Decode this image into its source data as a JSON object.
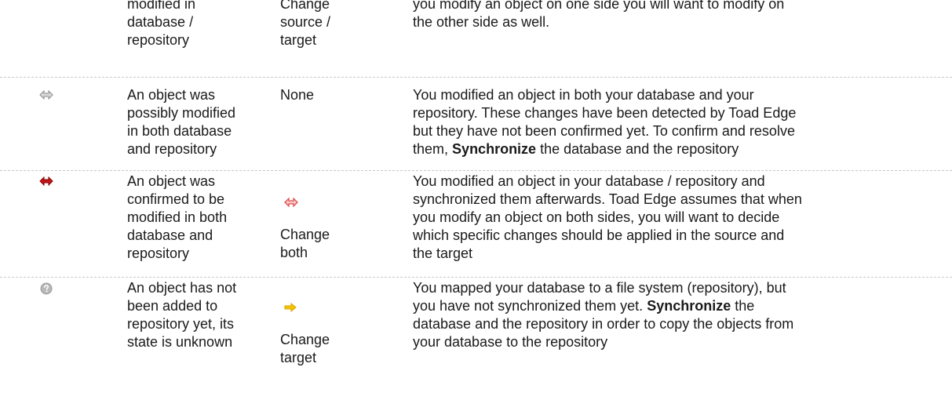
{
  "rows": [
    {
      "state_lines": [
        "modified in",
        "database /",
        "repository"
      ],
      "action_lines": [
        "Change",
        "source /",
        "target"
      ],
      "desc_lines": [
        "you modify an object on one side you will want to modify on",
        "the other side as well."
      ]
    },
    {
      "icon": "gray-double-arrow-icon",
      "state_lines": [
        "An object was",
        "possibly modified",
        "in both database",
        "and repository"
      ],
      "action_lines": [
        "None"
      ],
      "desc_lines": [
        "You modified an object in both your database and your",
        "repository. These changes have been detected by Toad Edge",
        "but they have not been confirmed yet. To confirm and resolve",
        "them,"
      ],
      "desc_bold": "Synchronize",
      "desc_tail": " the database and the repository"
    },
    {
      "icon": "red-double-arrow-icon",
      "state_lines": [
        "An object was",
        "confirmed to be",
        "modified in both",
        "database and",
        "repository"
      ],
      "action_icon": "red-outline-double-arrow-icon",
      "action_lines": [
        "Change",
        "both"
      ],
      "desc_lines": [
        "You modified an object in your database / repository and",
        "synchronized them afterwards. Toad Edge assumes that when",
        "you modify an object on both sides, you will want to decide",
        "which specific changes should be applied in the source and",
        "the target"
      ]
    },
    {
      "icon": "gray-question-icon",
      "state_lines": [
        "An object has not",
        "been added to",
        "repository yet, its",
        "state is unknown"
      ],
      "action_icon": "yellow-right-arrow-icon",
      "action_lines": [
        "Change",
        "target"
      ],
      "desc_lines": [
        "You mapped your database to a file system (repository), but",
        "you have not synchronized them yet."
      ],
      "desc_bold": "Synchronize",
      "desc_tail": " the",
      "desc_lines_after": [
        "database and the repository in order to copy the objects from",
        "your database to the repository"
      ]
    }
  ]
}
